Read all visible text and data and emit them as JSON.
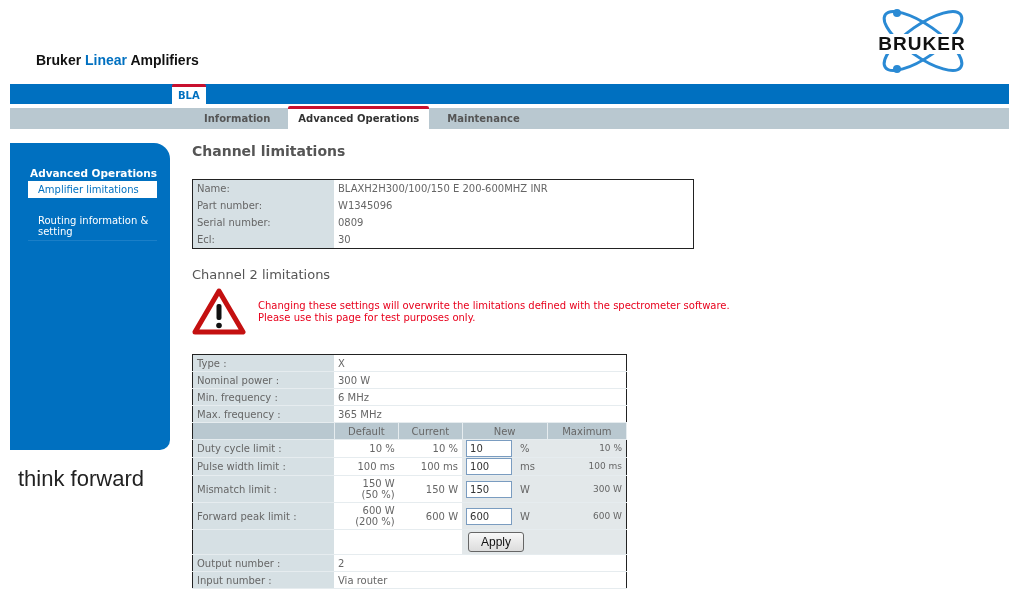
{
  "header": {
    "title_start": "Bruker ",
    "title_highlight": "Linear",
    "title_end": " Amplifiers",
    "logo_text": "BRUKER"
  },
  "top_tabs": [
    {
      "label": "BLA",
      "selected": true
    }
  ],
  "nav_tabs": [
    {
      "label": "Information",
      "selected": false
    },
    {
      "label": "Advanced Operations",
      "selected": true
    },
    {
      "label": "Maintenance",
      "selected": false
    }
  ],
  "sidebar": {
    "heading": "Advanced Operations",
    "items": [
      {
        "label": "Amplifier limitations",
        "selected": true
      },
      {
        "label": "Routing information & setting",
        "selected": false
      }
    ]
  },
  "tagline": "think forward",
  "page_heading": "Channel limitations",
  "info_rows": [
    {
      "label": "Name:",
      "value": "BLAXH2H300/100/150 E 200-600MHZ INR"
    },
    {
      "label": "Part number:",
      "value": "W1345096"
    },
    {
      "label": "Serial number:",
      "value": "0809"
    },
    {
      "label": "Ecl:",
      "value": "30"
    }
  ],
  "channel_heading": "Channel 2 limitations",
  "warning": {
    "lines": [
      "Changing these settings will overwrite the limitations defined with the spectrometer software.",
      "Please use this page for test purposes only."
    ]
  },
  "limits": {
    "top_rows": [
      {
        "label": "Type :",
        "value": "X"
      },
      {
        "label": "Nominal power :",
        "value": "300 W"
      },
      {
        "label": "Min. frequency :",
        "value": "6 MHz"
      },
      {
        "label": "Max. frequency :",
        "value": "365 MHz"
      }
    ],
    "columns": [
      "Default",
      "Current",
      "New",
      "Maximum"
    ],
    "rows": [
      {
        "label": "Duty cycle limit :",
        "default": [
          "10 %"
        ],
        "current": "10 %",
        "new_value": "10",
        "unit": "%",
        "maximum": "10 %"
      },
      {
        "label": "Pulse width limit :",
        "default": [
          "100 ms"
        ],
        "current": "100 ms",
        "new_value": "100",
        "unit": "ms",
        "maximum": "100 ms"
      },
      {
        "label": "Mismatch limit :",
        "default": [
          "150 W",
          "(50 %)"
        ],
        "current": "150 W",
        "new_value": "150",
        "unit": "W",
        "maximum": "300 W"
      },
      {
        "label": "Forward peak limit :",
        "default": [
          "600 W",
          "(200 %)"
        ],
        "current": "600 W",
        "new_value": "600",
        "unit": "W",
        "maximum": "600 W"
      }
    ],
    "apply_button": "Apply",
    "bottom_rows": [
      {
        "label": "Output number :",
        "value": "2"
      },
      {
        "label": "Input number :",
        "value": "Via router"
      }
    ]
  }
}
